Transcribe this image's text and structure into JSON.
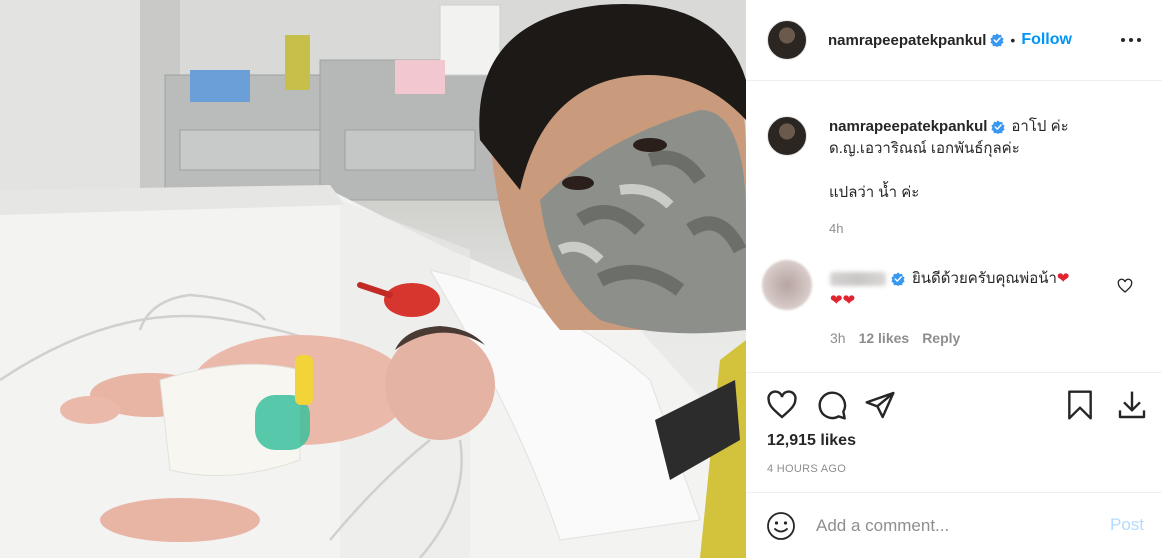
{
  "photo": {
    "alt": "",
    "colors": {
      "mask": "#8c8f8a",
      "hair": "#1d1916",
      "skin": "#c99a7c",
      "bed": "#f3f3f2",
      "bulb": "#d7362f"
    }
  },
  "header": {
    "username": "namrapeepatekpankul",
    "verified_icon": "verified-badge",
    "separator": "•",
    "follow_label": "Follow",
    "more_icon": "more-options-icon"
  },
  "caption": {
    "username": "namrapeepatekpankul",
    "line1": "อาโป ค่ะ",
    "line2": "ด.ญ.เอวาริณณ์ เอกพันธ์กุลค่ะ",
    "line3": "แปลว่า น้ำ ค่ะ",
    "time": "4h"
  },
  "comment": {
    "text": "ยินดีด้วยครับคุณพ่อน้า",
    "hearts_inline": "❤",
    "hearts_line2": "❤❤",
    "time": "3h",
    "likes": "12 likes",
    "reply": "Reply"
  },
  "actions": {
    "likes": "12,915 likes",
    "timestamp": "4 HOURS AGO",
    "icons": [
      "like-icon",
      "comment-icon",
      "share-icon",
      "save-icon",
      "download-icon"
    ]
  },
  "add_comment": {
    "placeholder": "Add a comment...",
    "post_label": "Post",
    "emoji_icon": "emoji-icon"
  },
  "colors": {
    "accent": "#0095f6",
    "muted": "#8e8e8e",
    "text": "#262626",
    "post_disabled": "#b3dbff",
    "heart": "#e0232e"
  }
}
